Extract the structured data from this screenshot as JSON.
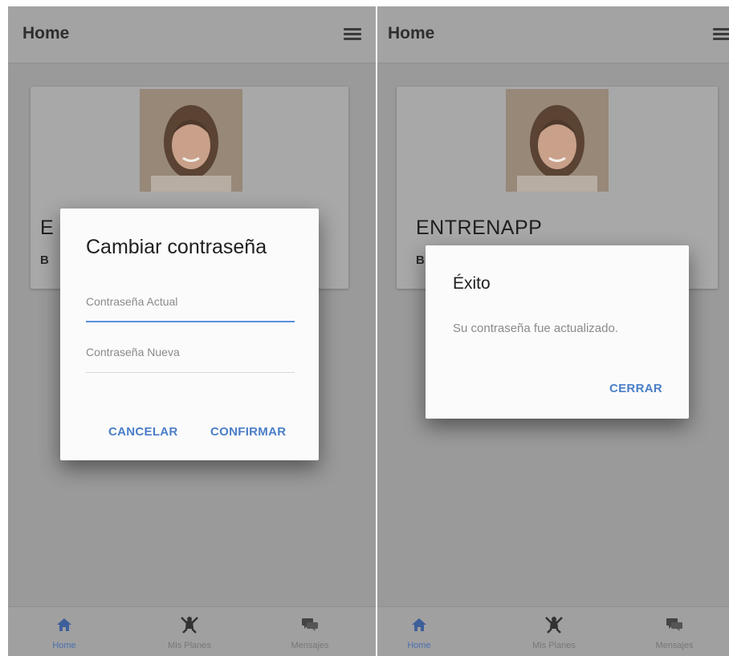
{
  "left_screen": {
    "app_bar": {
      "title": "Home",
      "menu_icon": "hamburger-menu-icon"
    },
    "profile_card": {
      "photo": "profile-photo",
      "title_partial": "E",
      "subtitle_partial": "B"
    },
    "dialog": {
      "title": "Cambiar contraseña",
      "current_password": {
        "placeholder": "Contraseña Actual",
        "value": ""
      },
      "new_password": {
        "placeholder": "Contraseña Nueva",
        "value": ""
      },
      "cancel_label": "CANCELAR",
      "confirm_label": "CONFIRMAR"
    },
    "bottom_nav": [
      {
        "label": "Home",
        "icon": "home-icon",
        "active": true
      },
      {
        "label": "Mis Planes",
        "icon": "fitness-icon",
        "active": false
      },
      {
        "label": "Mensajes",
        "icon": "chat-icon",
        "active": false
      }
    ]
  },
  "right_screen": {
    "app_bar": {
      "title": "Home",
      "menu_icon": "hamburger-menu-icon"
    },
    "profile_card": {
      "photo": "profile-photo",
      "title": "ENTRENAPP",
      "subtitle_partial": "B"
    },
    "dialog": {
      "title": "Éxito",
      "message": "Su contraseña fue actualizado.",
      "close_label": "CERRAR"
    },
    "bottom_nav": [
      {
        "label": "Home",
        "icon": "home-icon",
        "active": true
      },
      {
        "label": "Mis Planes",
        "icon": "fitness-icon",
        "active": false
      },
      {
        "label": "Mensajes",
        "icon": "chat-icon",
        "active": false
      }
    ]
  },
  "colors": {
    "accent": "#4a7ec8",
    "focused_underline": "#5b8ee0",
    "overlay": "#9a9a9a",
    "dialog_bg": "#fbfbfb"
  }
}
